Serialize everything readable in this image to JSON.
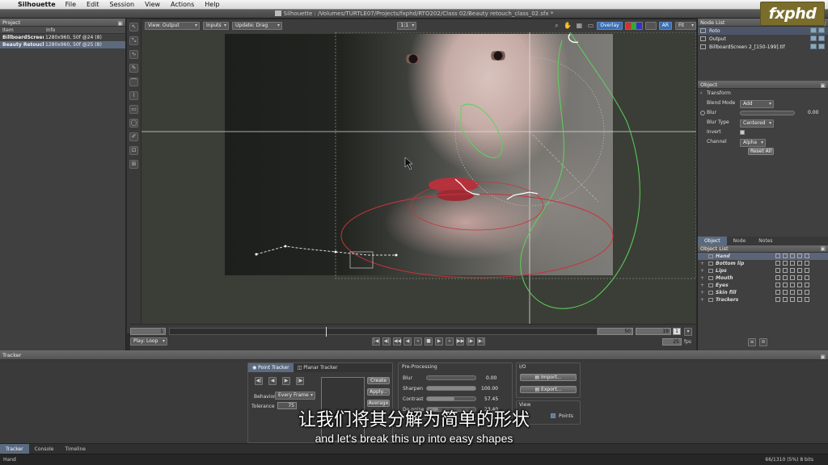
{
  "menubar": {
    "app": "Silhouette",
    "items": [
      "File",
      "Edit",
      "Session",
      "View",
      "Actions",
      "Help"
    ]
  },
  "logo_text": "fxphd",
  "window_title": "Silhouette : /Volumes/TURTLE07/Projects/fxphd/RTO202/Class 02/Beauty retouch_class_02.sfx *",
  "project": {
    "title": "Project",
    "columns": [
      "Item",
      "Info"
    ],
    "rows": [
      {
        "item": "BillboardScreen...",
        "info": "1280x960, 50f @24 (8)"
      },
      {
        "item": "Beauty Retouch",
        "info": "1280x960, 50f @25 (8)"
      }
    ]
  },
  "viewer_toolbar": {
    "view": "View: Output",
    "inputs": "Inputs",
    "update": "Update: Drag",
    "zoom_ratio": "1:1",
    "overlay": "Overlay",
    "ar": "AR",
    "fit": "Fit"
  },
  "timeline": {
    "start": "1",
    "end": "50",
    "current": "19",
    "step": "1",
    "play_mode": "Play: Loop",
    "fps": "25",
    "fps_label": "fps"
  },
  "node_list": {
    "title": "Node List",
    "nodes": [
      "Roto",
      "Output",
      "BillboardScreen 2_[150-199].tif"
    ]
  },
  "object_panel": {
    "title": "Object",
    "transform": "Transform",
    "blend_mode_label": "Blend Mode",
    "blend_mode": "Add",
    "blur_label": "Blur",
    "blur_value": "0.00",
    "blur_type_label": "Blur Type",
    "blur_type": "Centered",
    "invert_label": "Invert",
    "channel_label": "Channel",
    "channel": "Alpha",
    "reset_all": "Reset All"
  },
  "object_tabs": [
    "Object",
    "Node",
    "Notes"
  ],
  "object_list": {
    "title": "Object List",
    "items": [
      "Hand",
      "Bottom lip",
      "Lips",
      "Mouth",
      "Eyes",
      "Skin fill",
      "Trackers"
    ]
  },
  "tracker": {
    "title": "Tracker",
    "tabs": [
      "Point Tracker",
      "Planar Tracker"
    ],
    "behavior_label": "Behavior",
    "behavior": "Every Frame",
    "tolerance_label": "Tolerance",
    "tolerance": "75",
    "create": "Create",
    "apply": "Apply...",
    "average": "Average",
    "preprocessing_title": "Pre-Processing",
    "blur_label": "Blur",
    "blur_value": "0.00",
    "sharpen_label": "Sharpen",
    "sharpen_value": "100.00",
    "contrast_label": "Contrast",
    "contrast_value": "57.45",
    "denoise_label": "De-noise",
    "denoise_value": "23.40",
    "io_title": "I/O",
    "import": "Import...",
    "export": "Export...",
    "view_title": "View",
    "points": "Points"
  },
  "bottom_tabs": [
    "Tracker",
    "Console",
    "Timeline"
  ],
  "status": {
    "left": "Hand",
    "right": "66/1310 (5%) 8 bits"
  },
  "subtitles": {
    "zh": "让我们将其分解为简单的形状",
    "en": "and let's break this up into easy shapes"
  }
}
